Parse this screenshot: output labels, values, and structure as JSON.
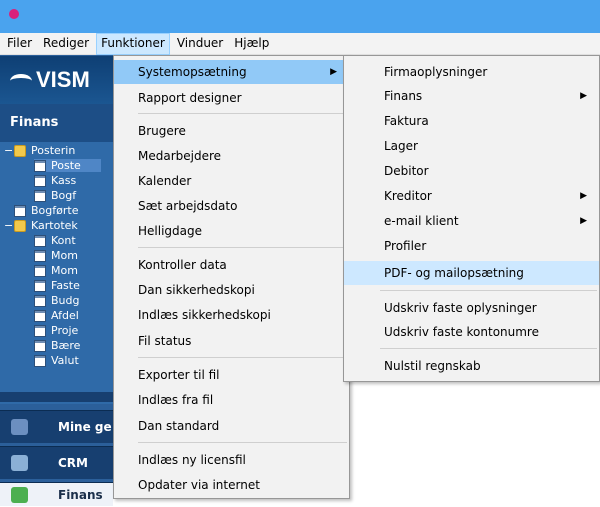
{
  "menubar": [
    "Filer",
    "Rediger",
    "Funktioner",
    "Vinduer",
    "Hjælp"
  ],
  "logo": "VISM",
  "left_panel": {
    "header": "Finans",
    "tree": [
      "Posterin",
      "Poste",
      "Kass",
      "Bogf",
      "Bogførte",
      "Kartotek",
      "Kont",
      "Mom",
      "Mom",
      "Faste",
      "Budg",
      "Afdel",
      "Proje",
      "Bære",
      "Valut"
    ],
    "strips": [
      "Mine ge",
      "CRM",
      "Finans"
    ]
  },
  "funktioner_menu": {
    "items": [
      "Systemopsætning",
      "Rapport designer",
      "Brugere",
      "Medarbejdere",
      "Kalender",
      "Sæt arbejdsdato",
      "Helligdage",
      "Kontroller data",
      "Dan sikkerhedskopi",
      "Indlæs sikkerhedskopi",
      "Fil status",
      "Exporter til fil",
      "Indlæs fra fil",
      "Dan standard",
      "Indlæs ny licensfil",
      "Opdater via internet"
    ]
  },
  "system_submenu": {
    "items": [
      "Firmaoplysninger",
      "Finans",
      "Faktura",
      "Lager",
      "Debitor",
      "Kreditor",
      "e-mail klient",
      "Profiler",
      "PDF- og mailopsætning",
      "Udskriv faste oplysninger",
      "Udskriv faste kontonumre",
      "Nulstil regnskab"
    ]
  },
  "colors": {
    "titlebar": "#4aa3ee",
    "menu_highlight": "#91c9f7",
    "submenu_highlight": "#cde8ff",
    "sidebar": "#2b5f9a"
  },
  "icons": [
    "app-icon",
    "vismanet-logo",
    "folder-icon",
    "table-icon",
    "submenu-arrow-icon"
  ]
}
